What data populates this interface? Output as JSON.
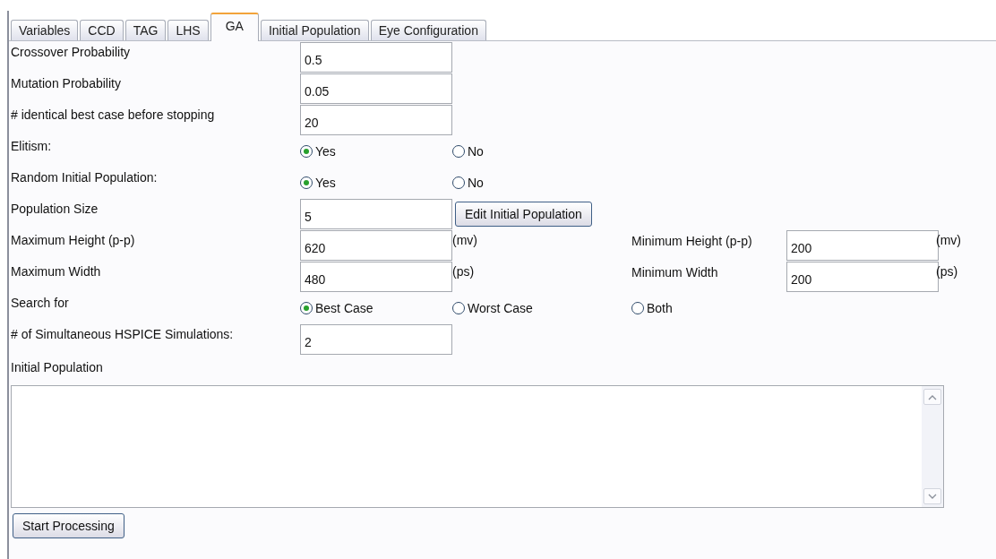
{
  "tabs": [
    {
      "label": "Variables",
      "selected": false
    },
    {
      "label": "CCD",
      "selected": false
    },
    {
      "label": "TAG",
      "selected": false
    },
    {
      "label": "LHS",
      "selected": false
    },
    {
      "label": "GA",
      "selected": true
    },
    {
      "label": "Initial Population",
      "selected": false
    },
    {
      "label": "Eye Configuration",
      "selected": false
    }
  ],
  "rows": [
    {
      "label": "Crossover Probability",
      "cells": [
        {
          "kind": "field",
          "value": "0.5"
        }
      ]
    },
    {
      "label": "Mutation Probability",
      "cells": [
        {
          "kind": "field",
          "value": "0.05"
        }
      ]
    },
    {
      "label": "# identical best case before stopping",
      "cells": [
        {
          "kind": "field",
          "value": "20"
        }
      ]
    },
    {
      "label": "Elitism:",
      "cells": [
        {
          "kind": "radio",
          "label": "Yes",
          "selected": true
        },
        {
          "kind": "radio",
          "label": "No",
          "selected": false
        }
      ]
    },
    {
      "label": "Random Initial Population:",
      "cells": [
        {
          "kind": "radio",
          "label": "Yes",
          "selected": true
        },
        {
          "kind": "radio",
          "label": "No",
          "selected": false
        }
      ]
    },
    {
      "label": "Population Size",
      "cells": [
        {
          "kind": "field",
          "value": "5"
        },
        {
          "kind": "button",
          "label": "Edit Initial Population"
        }
      ]
    },
    {
      "label": "Maximum Height (p-p)",
      "cells": [
        {
          "kind": "field",
          "value": "620"
        },
        {
          "kind": "unit",
          "text": "(mv)"
        },
        {
          "kind": "label",
          "text": "Minimum Height (p-p)"
        },
        {
          "kind": "field",
          "value": "200"
        },
        {
          "kind": "unit",
          "text": "(mv)"
        }
      ]
    },
    {
      "label": "Maximum Width",
      "cells": [
        {
          "kind": "field",
          "value": "480"
        },
        {
          "kind": "unit",
          "text": "(ps)"
        },
        {
          "kind": "label",
          "text": "Minimum Width"
        },
        {
          "kind": "field",
          "value": "200"
        },
        {
          "kind": "unit",
          "text": "(ps)"
        }
      ]
    },
    {
      "label": "Search for",
      "cells": [
        {
          "kind": "radio",
          "label": "Best Case",
          "selected": true
        },
        {
          "kind": "radio",
          "label": "Worst Case",
          "selected": false
        },
        {
          "kind": "radio",
          "label": "Both",
          "selected": false
        }
      ]
    },
    {
      "label": "# of Simultaneous HSPICE Simulations:",
      "cells": [
        {
          "kind": "field",
          "value": "2"
        }
      ]
    }
  ],
  "initial_population": {
    "label": "Initial Population"
  },
  "start_button": {
    "label": "Start Processing"
  }
}
